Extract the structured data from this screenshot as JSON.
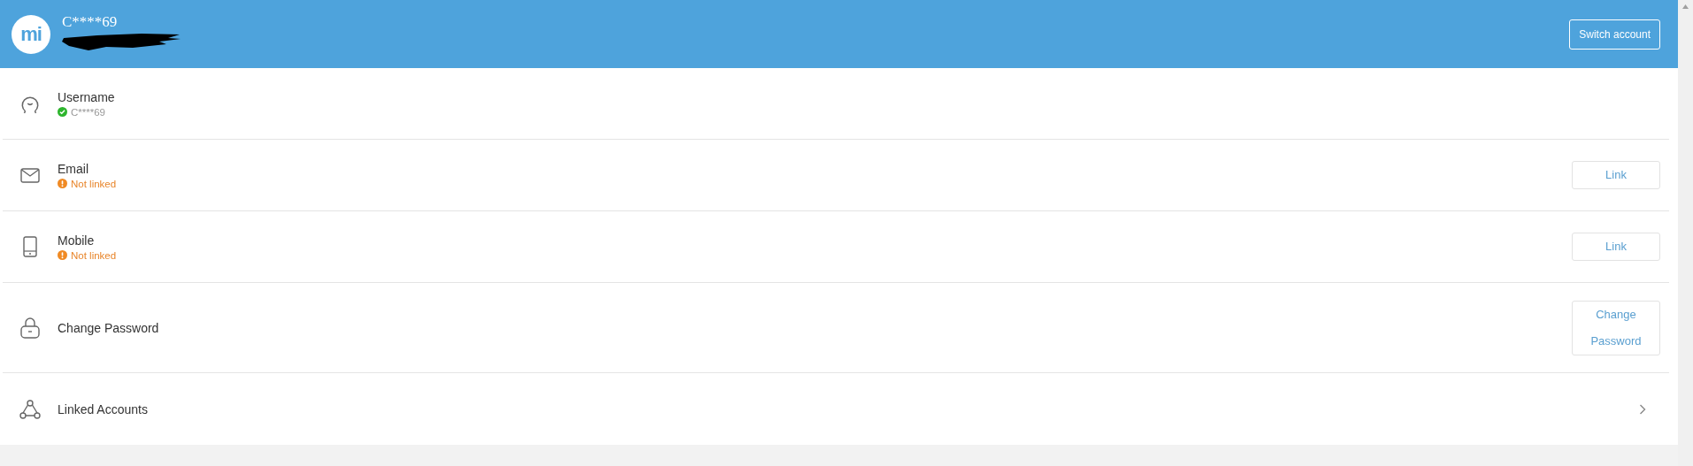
{
  "header": {
    "logo_text": "mi",
    "account_name": "C****69",
    "switch_button": "Switch account"
  },
  "rows": [
    {
      "kind": "user",
      "title": "Username",
      "status": {
        "kind": "verified",
        "text": "C****69"
      },
      "action": {
        "kind": "none"
      }
    },
    {
      "kind": "mail",
      "title": "Email",
      "status": {
        "kind": "warning",
        "text": "Not linked"
      },
      "action": {
        "kind": "button",
        "label": "Link"
      }
    },
    {
      "kind": "phone",
      "title": "Mobile",
      "status": {
        "kind": "warning",
        "text": "Not linked"
      },
      "action": {
        "kind": "button",
        "label": "Link"
      }
    },
    {
      "kind": "lock",
      "title": "Change Password",
      "action": {
        "kind": "button",
        "label": "Change Password"
      }
    },
    {
      "kind": "accounts",
      "title": "Linked Accounts",
      "action": {
        "kind": "chevron"
      }
    }
  ]
}
